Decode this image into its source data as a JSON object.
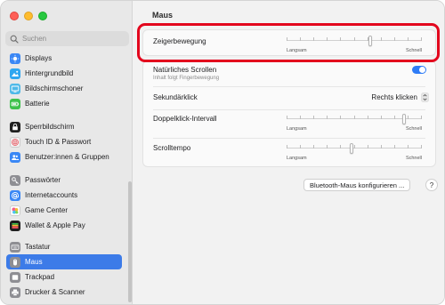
{
  "window": {
    "title": "Maus"
  },
  "search": {
    "placeholder": "Suchen"
  },
  "sidebar": {
    "items": [
      {
        "label": "Displays",
        "icon": "display-icon",
        "color": "#3a87f5"
      },
      {
        "label": "Hintergrundbild",
        "icon": "wallpaper-icon",
        "color": "#2fa6f0"
      },
      {
        "label": "Bildschirmschoner",
        "icon": "screensaver-icon",
        "color": "#4fb9e8"
      },
      {
        "label": "Batterie",
        "icon": "battery-icon",
        "color": "#3ec14c"
      },
      {
        "label": "Sperrbildschirm",
        "icon": "lock-screen-icon",
        "color": "#1f1f1f"
      },
      {
        "label": "Touch ID & Passwort",
        "icon": "fingerprint-icon",
        "color": "#f2f2f2"
      },
      {
        "label": "Benutzer:innen & Gruppen",
        "icon": "users-icon",
        "color": "#3a87f5"
      },
      {
        "label": "Passwörter",
        "icon": "key-icon",
        "color": "#8e8e93"
      },
      {
        "label": "Internetaccounts",
        "icon": "at-icon",
        "color": "#3a87f5"
      },
      {
        "label": "Game Center",
        "icon": "game-center-icon",
        "color": "#ffffff"
      },
      {
        "label": "Wallet & Apple Pay",
        "icon": "wallet-icon",
        "color": "#1f1f1f"
      },
      {
        "label": "Tastatur",
        "icon": "keyboard-icon",
        "color": "#8e8e93"
      },
      {
        "label": "Maus",
        "icon": "mouse-icon",
        "color": "#8e8e93",
        "selected": true
      },
      {
        "label": "Trackpad",
        "icon": "trackpad-icon",
        "color": "#8e8e93"
      },
      {
        "label": "Drucker & Scanner",
        "icon": "printer-icon",
        "color": "#8e8e93"
      }
    ]
  },
  "settings": {
    "pointer_speed": {
      "label": "Zeigerbewegung",
      "min_label": "Langsam",
      "max_label": "Schnell",
      "value": 0.62
    },
    "natural_scrolling": {
      "label": "Natürliches Scrollen",
      "sublabel": "Inhalt folgt Fingerbewegung",
      "enabled": true
    },
    "secondary_click": {
      "label": "Sekundärklick",
      "value": "Rechts klicken"
    },
    "double_click": {
      "label": "Doppelklick-Intervall",
      "min_label": "Langsam",
      "max_label": "Schnell",
      "value": 0.88
    },
    "scroll_speed": {
      "label": "Scrolltempo",
      "min_label": "Langsam",
      "max_label": "Schnell",
      "value": 0.48
    }
  },
  "actions": {
    "bluetooth_button": "Bluetooth-Maus konfigurieren ...",
    "help": "?"
  },
  "colors": {
    "accent": "#3c7be8",
    "highlight": "#e3061d",
    "toggle_on": "#2f7cf6"
  }
}
